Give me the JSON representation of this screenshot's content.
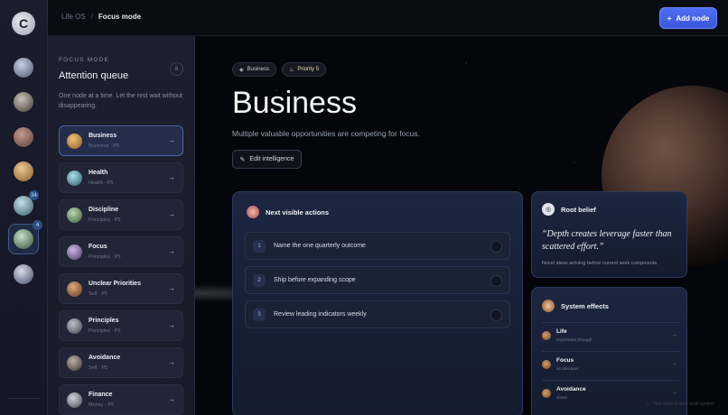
{
  "breadcrumb": {
    "root": "Life OS",
    "separator": "/",
    "current": "Focus mode"
  },
  "header": {
    "add_node_label": "Add node",
    "add_icon": "plus-icon"
  },
  "rail": {
    "logo_glyph": "C",
    "items": [
      {
        "name": "node-1",
        "colors": [
          "#c7cfe0",
          "#4a5672"
        ]
      },
      {
        "name": "node-2",
        "colors": [
          "#c9c0b8",
          "#3e3a3a"
        ]
      },
      {
        "name": "node-3",
        "colors": [
          "#c49a8a",
          "#5a3d3d"
        ]
      },
      {
        "name": "node-4",
        "colors": [
          "#e9c892",
          "#8a5a2a"
        ]
      },
      {
        "name": "node-5",
        "colors": [
          "#bfe0ea",
          "#3b5a6a"
        ],
        "badge": "34"
      },
      {
        "name": "node-6",
        "colors": [
          "#c8e0c8",
          "#2f4f3a"
        ],
        "badge": "4",
        "active": true
      },
      {
        "name": "node-7",
        "colors": [
          "#d8dbe6",
          "#404a68"
        ]
      }
    ]
  },
  "queue": {
    "eyebrow": "FOCUS MODE",
    "title": "Attention queue",
    "count": "8",
    "description": "One node at a time. Let the rest wait without disappearing.",
    "items": [
      {
        "name": "Business",
        "sub": "Business · P5",
        "colors": [
          "#f0c27a",
          "#8a5a22"
        ],
        "active": true
      },
      {
        "name": "Health",
        "sub": "Health · P5",
        "colors": [
          "#a8e0ec",
          "#2e5866"
        ]
      },
      {
        "name": "Discipline",
        "sub": "Principles · P5",
        "colors": [
          "#b8d8b0",
          "#3a5a3a"
        ]
      },
      {
        "name": "Focus",
        "sub": "Principles · P5",
        "colors": [
          "#c9b8e0",
          "#4a3a66"
        ]
      },
      {
        "name": "Unclear Priorities",
        "sub": "Self · P5",
        "colors": [
          "#e0a87a",
          "#5a3a22"
        ]
      },
      {
        "name": "Principles",
        "sub": "Principles · P5",
        "colors": [
          "#c0c4cc",
          "#3a3e48"
        ]
      },
      {
        "name": "Avoidance",
        "sub": "Self · P5",
        "colors": [
          "#b8b0a8",
          "#3a3430"
        ]
      },
      {
        "name": "Finance",
        "sub": "Money · P5",
        "colors": [
          "#d0d4dc",
          "#44484f"
        ]
      }
    ],
    "arrow": "→"
  },
  "main": {
    "chips": [
      {
        "label": "Business",
        "icon": "leaf-icon",
        "glyph": "◈"
      },
      {
        "label": "Priority 5",
        "icon": "flame-icon",
        "glyph": "♨"
      }
    ],
    "title": "Business",
    "subtitle": "Multiple valuable opportunities are competing for focus.",
    "edit_label": "Edit intelligence",
    "actions_card": {
      "title": "Next visible actions",
      "items": [
        {
          "num": "1",
          "text": "Name the one quarterly outcome"
        },
        {
          "num": "2",
          "text": "Ship before expanding scope"
        },
        {
          "num": "3",
          "text": "Review leading indicators weekly"
        }
      ]
    },
    "belief_card": {
      "title": "Root belief",
      "quote": "“Depth creates leverage faster than scattered effort.”",
      "note": "Novel ideas arriving before current work compounds."
    },
    "effects_card": {
      "title": "System effects",
      "items": [
        {
          "name": "Life",
          "sub": "expresses through"
        },
        {
          "name": "Focus",
          "sub": "accelerates"
        },
        {
          "name": "Avoidance",
          "sub": "slows"
        }
      ]
    },
    "footer_hint": "This stays in your local system"
  },
  "colors": {
    "accent": "#4d6ef5",
    "panel": "#1d1f2e",
    "card": "#1c2640"
  }
}
